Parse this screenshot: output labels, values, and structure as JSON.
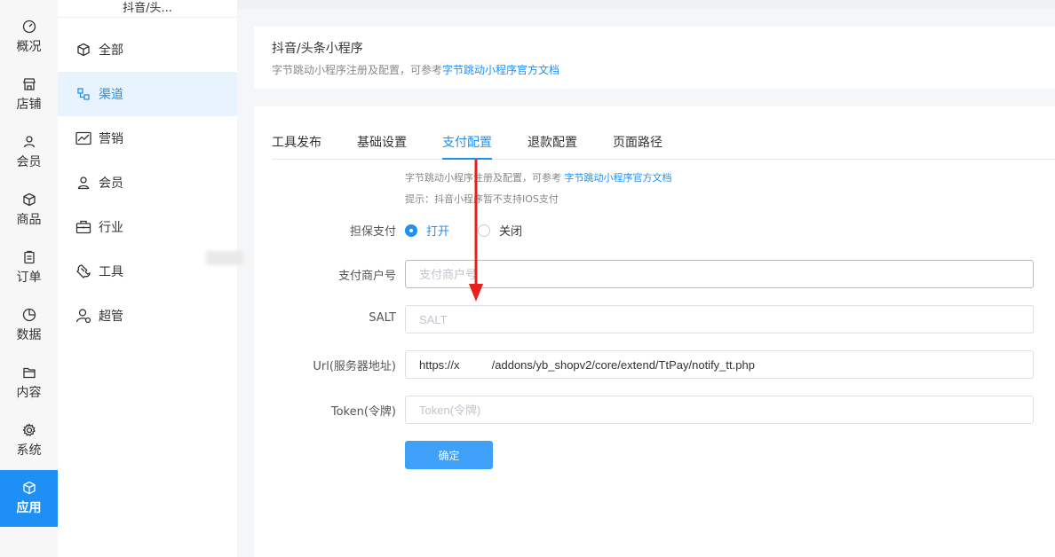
{
  "rail": {
    "items": [
      {
        "label": "概况",
        "icon": "dashboard-icon"
      },
      {
        "label": "店铺",
        "icon": "store-icon"
      },
      {
        "label": "会员",
        "icon": "user-icon"
      },
      {
        "label": "商品",
        "icon": "box-icon"
      },
      {
        "label": "订单",
        "icon": "clipboard-icon"
      },
      {
        "label": "数据",
        "icon": "pie-chart-icon"
      },
      {
        "label": "内容",
        "icon": "folder-icon"
      },
      {
        "label": "系统",
        "icon": "gear-icon"
      },
      {
        "label": "应用",
        "icon": "cube-icon"
      }
    ],
    "active": "应用"
  },
  "subnav": {
    "header": "抖音/头...",
    "items": [
      {
        "label": "全部",
        "icon": "cube-icon"
      },
      {
        "label": "渠道",
        "icon": "channel-icon"
      },
      {
        "label": "营销",
        "icon": "trend-icon"
      },
      {
        "label": "会员",
        "icon": "user-icon"
      },
      {
        "label": "行业",
        "icon": "briefcase-icon"
      },
      {
        "label": "工具",
        "icon": "wrench-icon"
      },
      {
        "label": "超管",
        "icon": "admin-icon"
      }
    ],
    "active": "渠道"
  },
  "header": {
    "title": "抖音/头条小程序",
    "desc_prefix": "字节跳动小程序注册及配置，可参考",
    "desc_link": "字节跳动小程序官方文档"
  },
  "tabs": [
    "工具发布",
    "基础设置",
    "支付配置",
    "退款配置",
    "页面路径"
  ],
  "active_tab": "支付配置",
  "form": {
    "hint1_prefix": "字节跳动小程序注册及配置，可参考 ",
    "hint1_link": "字节跳动小程序官方文档",
    "hint2": "提示：抖音小程序暂不支持IOS支付",
    "escrow_label": "担保支付",
    "escrow_on": "打开",
    "escrow_off": "关闭",
    "escrow_value": "打开",
    "merchant_label": "支付商户号",
    "merchant_placeholder": "支付商户号",
    "merchant_value": "",
    "salt_label": "SALT",
    "salt_placeholder": "SALT",
    "salt_value": "",
    "url_label": "Url(服务器地址)",
    "url_value": "https://x          /addons/yb_shopv2/core/extend/TtPay/notify_tt.php",
    "token_label": "Token(令牌)",
    "token_placeholder": "Token(令牌)",
    "token_value": "",
    "submit_label": "确定"
  },
  "colors": {
    "accent": "#1e90f5",
    "button": "#3fa0fa",
    "annotation_arrow": "#e8201a"
  }
}
